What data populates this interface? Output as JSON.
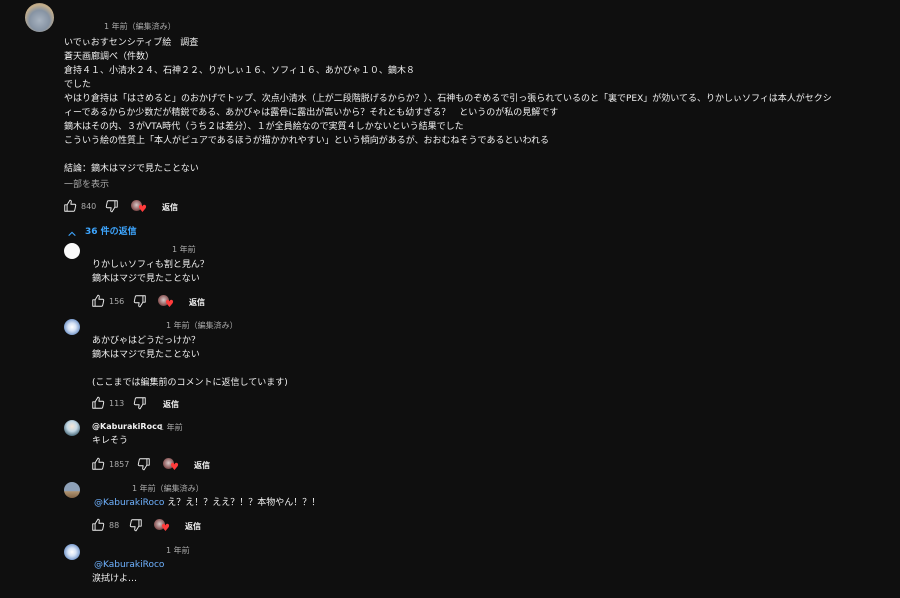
{
  "top_comment": {
    "timestamp": "1 年前（編集済み）",
    "lines": [
      "いでぃおすセンシティブ絵　調査",
      "蒼天画廊調べ（件数）",
      "倉持４１、小清水２４、石神２２、りかしぃ１６、ソフィ１６、あかびゃ１０、鏑木８",
      "でした",
      "やはり倉持は「はさめると」のおかげでトップ、次点小清水（上が二段階脱げるからか？）、石神ものぞめるで引っ張られているのと「裏でPEX」が効いてる、りかしぃソフィは本人がセクシ",
      "ィーであるからか少数だが精鋭である、あかびゃは露骨に露出が高いから？それとも幼すぎる？　というのが私の見解です",
      "鏑木はその内、３がVTA時代（うち２は差分）、１が全員絵なので実質４しかないという結果でした",
      "こういう絵の性質上「本人がピュアであるほうが描かかれやすい」という傾向があるが、おおむねそうであるといわれる",
      "",
      "結論：鏑木はマジで見たことない"
    ],
    "show_more": "一部を表示",
    "likes": "840",
    "reply_label": "返信"
  },
  "replies_toggle": "36 件の返信",
  "replies": [
    {
      "handle": "",
      "timestamp": "1 年前",
      "mention": "",
      "lines": [
        "りかしぃソフィも割と見ん？",
        "鏑木はマジで見たことない"
      ],
      "likes": "156",
      "reply_label": "返信",
      "creator_heart": true
    },
    {
      "handle": "",
      "timestamp": "1 年前（編集済み）",
      "mention": "",
      "lines": [
        "あかびゃはどうだっけか？",
        "鏑木はマジで見たことない",
        "",
        "(ここまでは編集前のコメントに返信しています)"
      ],
      "likes": "113",
      "reply_label": "返信",
      "creator_heart": false
    },
    {
      "handle": "@KaburakiRoco",
      "timestamp": "1 年前",
      "mention": "",
      "lines": [
        "キレそう"
      ],
      "likes": "1857",
      "reply_label": "返信",
      "creator_heart": true
    },
    {
      "handle": "",
      "timestamp": "1 年前（編集済み）",
      "mention": "@KaburakiRoco",
      "lines": [
        "え？え！？ええ？！？本物やん！？！"
      ],
      "likes": "88",
      "reply_label": "返信",
      "creator_heart": true
    },
    {
      "handle": "",
      "timestamp": "1 年前",
      "mention": "@KaburakiRoco",
      "lines": [
        "涙拭けよ…"
      ],
      "likes": "",
      "reply_label": "",
      "creator_heart": false
    }
  ],
  "icons": {
    "like": "thumbs-up-icon",
    "dislike": "thumbs-down-icon",
    "heart": "creator-heart-icon",
    "chevron": "chevron-up-icon"
  },
  "colors": {
    "background": "#0f0f0f",
    "text": "#f1f1f1",
    "secondary": "#aaaaaa",
    "link": "#3ea6ff",
    "heart": "#ff3b3b"
  }
}
